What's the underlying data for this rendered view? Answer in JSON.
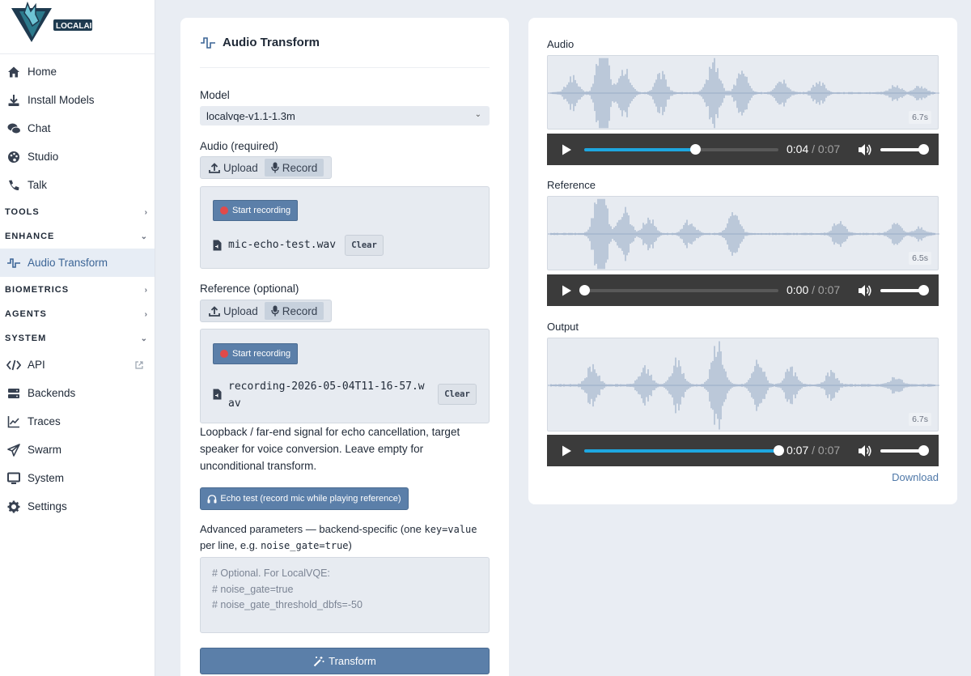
{
  "sidebar": {
    "logo_text": "LOCALAI",
    "items_top": [
      {
        "label": "Home",
        "icon": "home-icon"
      },
      {
        "label": "Install Models",
        "icon": "download-icon"
      },
      {
        "label": "Chat",
        "icon": "chat-icon"
      },
      {
        "label": "Studio",
        "icon": "palette-icon"
      },
      {
        "label": "Talk",
        "icon": "phone-icon"
      }
    ],
    "sections": {
      "tools": "TOOLS",
      "enhance": "ENHANCE",
      "biometrics": "BIOMETRICS",
      "agents": "AGENTS",
      "system": "SYSTEM"
    },
    "enhance_items": [
      {
        "label": "Audio Transform",
        "icon": "waveform-icon",
        "active": true
      }
    ],
    "system_items": [
      {
        "label": "API",
        "icon": "code-icon"
      },
      {
        "label": "Backends",
        "icon": "server-icon"
      },
      {
        "label": "Traces",
        "icon": "chart-line-icon"
      },
      {
        "label": "Swarm",
        "icon": "paper-plane-icon"
      },
      {
        "label": "System",
        "icon": "desktop-icon"
      },
      {
        "label": "Settings",
        "icon": "gear-icon"
      }
    ]
  },
  "form": {
    "title": "Audio Transform",
    "model_label": "Model",
    "model_value": "localvqe-v1.1-1.3m",
    "audio_label": "Audio (required)",
    "upload_label": "Upload",
    "record_label": "Record",
    "start_recording": "Start recording",
    "audio_file": "mic-echo-test.wav",
    "clear_label": "Clear",
    "reference_label": "Reference (optional)",
    "reference_file_line1": "recording-2026-05-04T11-16-57.w",
    "reference_file_line2": "av",
    "reference_help": "Loopback / far-end signal for echo cancellation, target speaker for voice conversion. Leave empty for unconditional transform.",
    "echo_test_label": "Echo test (record mic while playing reference)",
    "advanced_prefix": "Advanced parameters — backend-specific (one ",
    "advanced_code1": "key=value",
    "advanced_mid": " per line, e.g. ",
    "advanced_code2": "noise_gate=true",
    "advanced_suffix": ")",
    "advanced_placeholder": "# Optional. For LocalVQE:\n# noise_gate=true\n# noise_gate_threshold_dbfs=-50",
    "transform_label": "Transform"
  },
  "results": {
    "audio": {
      "label": "Audio",
      "duration": "6.7s",
      "current": "0:04",
      "total": "0:07",
      "progress": 0.57
    },
    "reference": {
      "label": "Reference",
      "duration": "6.5s",
      "current": "0:00",
      "total": "0:07",
      "progress": 0.0
    },
    "output": {
      "label": "Output",
      "duration": "6.7s",
      "current": "0:07",
      "total": "0:07",
      "progress": 1.0
    },
    "separator": "/",
    "download_label": "Download"
  }
}
